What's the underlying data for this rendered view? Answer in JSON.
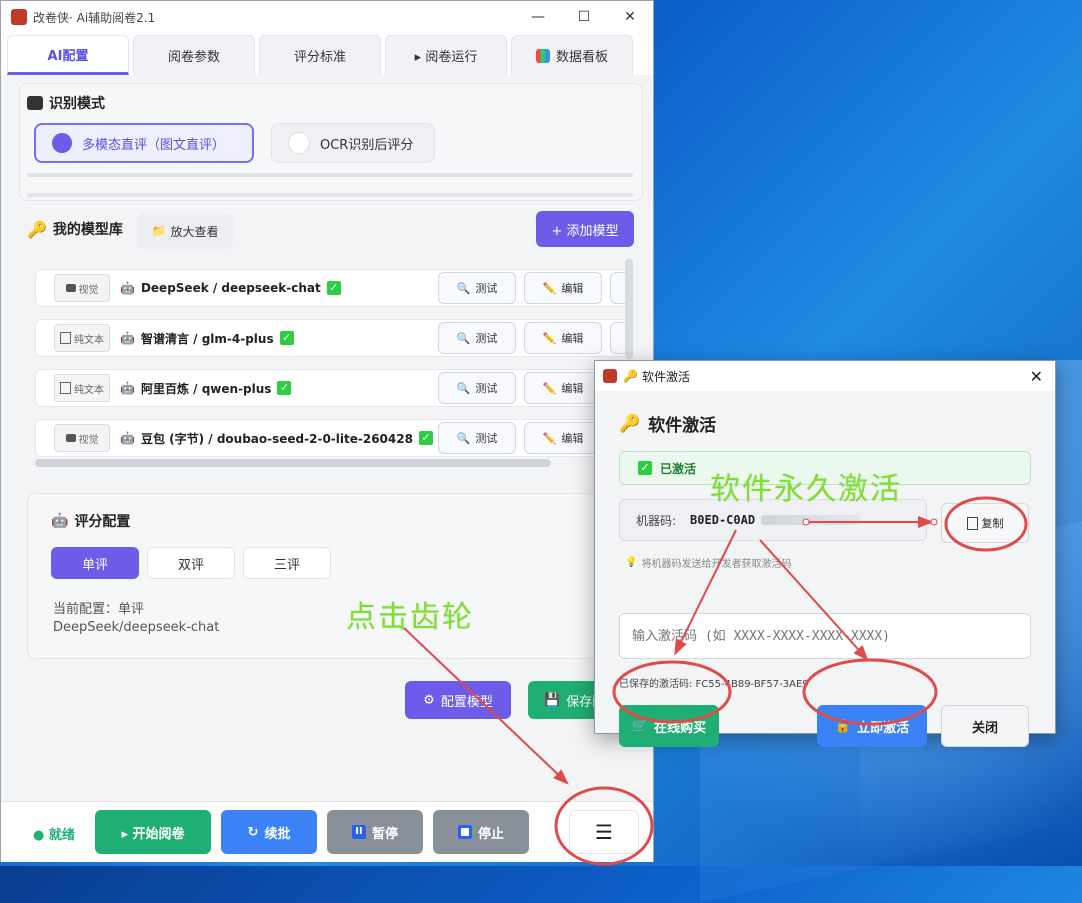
{
  "window": {
    "title": "改卷侠· Ai辅助阅卷2.1",
    "minimize": "—",
    "maximize": "☐",
    "close": "✕"
  },
  "tabs": [
    {
      "label": "AI配置"
    },
    {
      "label": "阅卷参数"
    },
    {
      "label": "评分标准"
    },
    {
      "label": "▸ 阅卷运行"
    },
    {
      "label": "数据看板"
    }
  ],
  "recognition": {
    "title": "识别模式",
    "options": [
      {
        "label": "多模态直评（图文直评）"
      },
      {
        "label": "OCR识别后评分"
      }
    ],
    "selected": 0
  },
  "model_library": {
    "title": "我的模型库",
    "zoom_label": "放大查看",
    "add_label": "+ 添加模型",
    "test_label": "测试",
    "edit_label": "编辑",
    "models": [
      {
        "tag": "视觉",
        "name": "DeepSeek / deepseek-chat",
        "checked": true
      },
      {
        "tag": "纯文本",
        "name": "智谱清言 / glm-4-plus",
        "checked": true
      },
      {
        "tag": "纯文本",
        "name": "阿里百炼 / qwen-plus",
        "checked": true
      },
      {
        "tag": "视觉",
        "name": "豆包 (字节) / doubao-seed-2-0-lite-260428",
        "checked": true
      }
    ]
  },
  "scoring": {
    "title": "评分配置",
    "modes": [
      {
        "label": "单评"
      },
      {
        "label": "双评"
      },
      {
        "label": "三评"
      }
    ],
    "selected": 0,
    "current_line1": "当前配置：单评",
    "current_line2": "DeepSeek/deepseek-chat"
  },
  "actions": {
    "config_model": "配置模型",
    "save": "保存配"
  },
  "bottom": {
    "status": "● 就绪",
    "start": "▸ 开始阅卷",
    "resume": "续批",
    "pause": "暂停",
    "stop": "停止",
    "menu": "☰"
  },
  "dialog": {
    "title": "软件激活",
    "heading": "软件激活",
    "activated": "已激活",
    "machine_code_label": "机器码:",
    "machine_code": "B0ED-C0AD",
    "copy": "复制",
    "hint": "将机器码发送给开发者获取激活码",
    "code_placeholder": "输入激活码 (如 XXXX-XXXX-XXXX-XXXX)",
    "saved_code": "已保存的激活码: FC55-4B89-BF57-3AE9",
    "buy": "在线购买",
    "activate": "立即激活",
    "close": "关闭"
  },
  "annotations": {
    "gear_text": "点击齿轮",
    "permanent_text": "软件永久激活"
  },
  "colors": {
    "accent": "#6c5ce7",
    "green": "#1fae74",
    "blue": "#3b82f6",
    "gray": "#8a909a",
    "annotation": "#7ee02e",
    "highlight": "#e04a4a"
  }
}
